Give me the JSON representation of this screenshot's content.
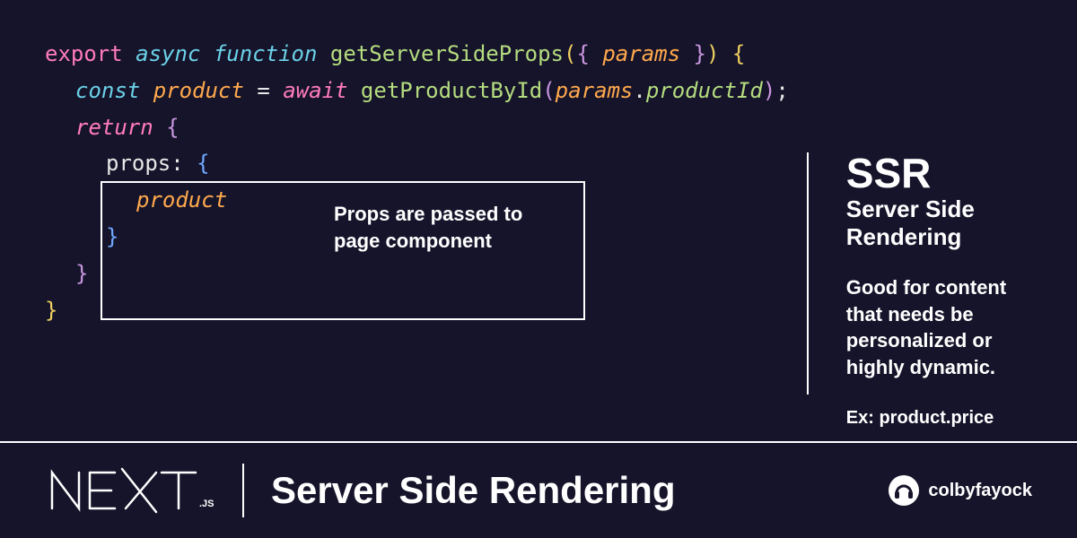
{
  "code": {
    "line1": {
      "export": "export",
      "async": "async",
      "function": "function",
      "fnName": "getServerSideProps",
      "param": "params"
    },
    "line2": {
      "const": "const",
      "varName": "product",
      "await": "await",
      "call": "getProductById",
      "obj": "params",
      "prop": "productId"
    },
    "line3": {
      "return": "return"
    },
    "line4": {
      "key": "props:"
    },
    "line5": {
      "val": "product"
    }
  },
  "annotation": "Props are passed to page component",
  "info": {
    "title": "SSR",
    "subtitle": "Server Side Rendering",
    "desc": "Good for content that needs be personalized or highly dynamic.",
    "example": "Ex: product.price"
  },
  "footer": {
    "logoMain": "NEXT",
    "logoSuffix": ".JS",
    "title": "Server Side Rendering",
    "credit": "colbyfayock"
  }
}
